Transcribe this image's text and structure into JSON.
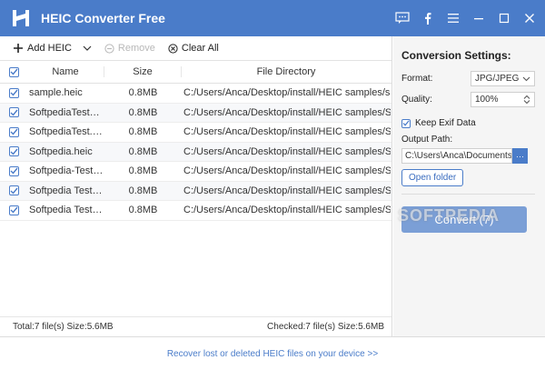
{
  "app": {
    "title": "HEIC Converter Free"
  },
  "toolbar": {
    "add_label": "Add HEIC",
    "remove_label": "Remove",
    "clear_label": "Clear All"
  },
  "table": {
    "columns": [
      "Name",
      "Size",
      "File Directory"
    ],
    "rows": [
      {
        "name": "sample.heic",
        "size": "0.8MB",
        "dir": "C:/Users/Anca/Desktop/install/HEIC samples/sample...."
      },
      {
        "name": "SoftpediaTested.h...",
        "size": "0.8MB",
        "dir": "C:/Users/Anca/Desktop/install/HEIC samples/Softped..."
      },
      {
        "name": "SoftpediaTest.heic",
        "size": "0.8MB",
        "dir": "C:/Users/Anca/Desktop/install/HEIC samples/Softped..."
      },
      {
        "name": "Softpedia.heic",
        "size": "0.8MB",
        "dir": "C:/Users/Anca/Desktop/install/HEIC samples/Softped..."
      },
      {
        "name": "Softpedia-Tested....",
        "size": "0.8MB",
        "dir": "C:/Users/Anca/Desktop/install/HEIC samples/Softped..."
      },
      {
        "name": "Softpedia Tested....",
        "size": "0.8MB",
        "dir": "C:/Users/Anca/Desktop/install/HEIC samples/Softped..."
      },
      {
        "name": "Softpedia Test.heic",
        "size": "0.8MB",
        "dir": "C:/Users/Anca/Desktop/install/HEIC samples/Softped..."
      }
    ]
  },
  "status": {
    "total": "Total:7 file(s) Size:5.6MB",
    "checked": "Checked:7 file(s) Size:5.6MB"
  },
  "settings": {
    "title": "Conversion Settings:",
    "format_label": "Format:",
    "format_value": "JPG/JPEG",
    "quality_label": "Quality:",
    "quality_value": "100%",
    "exif_label": "Keep Exif Data",
    "output_label": "Output Path:",
    "output_value": "C:\\Users\\Anca\\Documents\\Fo",
    "browse_label": "···",
    "open_folder_label": "Open folder",
    "convert_label": "Convert (7)"
  },
  "watermark": "SOFTPEDIA",
  "footer": {
    "link": "Recover lost or deleted HEIC files on your device >>"
  },
  "colors": {
    "accent": "#4a7cc9",
    "convert_bg": "#7b9fd6"
  }
}
